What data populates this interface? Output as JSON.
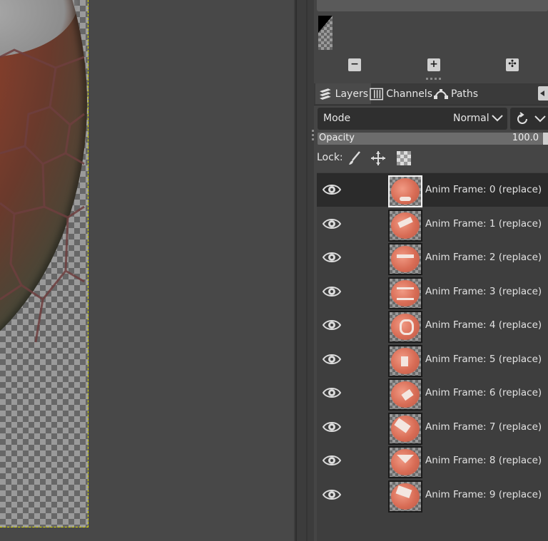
{
  "dock": {
    "tabs": [
      {
        "label": "Layers",
        "icon": "layers-icon",
        "active": true
      },
      {
        "label": "Channels",
        "icon": "channels-icon",
        "active": false
      },
      {
        "label": "Paths",
        "icon": "paths-icon",
        "active": false
      }
    ],
    "brush_buttons": [
      {
        "icon": "minus-icon",
        "glyph": "−"
      },
      {
        "icon": "plus-icon",
        "glyph": "+"
      },
      {
        "icon": "fit-icon",
        "glyph": "✣"
      }
    ]
  },
  "layers_panel": {
    "mode_label": "Mode",
    "mode_value": "Normal",
    "opacity_label": "Opacity",
    "opacity_value": "100.0",
    "opacity_fraction": 1.0,
    "lock_label": "Lock:",
    "lock_icons": [
      "paintbrush-icon",
      "move-icon",
      "alpha-checker-icon"
    ],
    "layers": [
      {
        "name": "Anim Frame: 0 (replace)",
        "visible": true,
        "selected": true
      },
      {
        "name": "Anim Frame: 1 (replace)",
        "visible": true,
        "selected": false
      },
      {
        "name": "Anim Frame: 2 (replace)",
        "visible": true,
        "selected": false
      },
      {
        "name": "Anim Frame: 3 (replace)",
        "visible": true,
        "selected": false
      },
      {
        "name": "Anim Frame: 4 (replace)",
        "visible": true,
        "selected": false
      },
      {
        "name": "Anim Frame: 5 (replace)",
        "visible": true,
        "selected": false
      },
      {
        "name": "Anim Frame: 6 (replace)",
        "visible": true,
        "selected": false
      },
      {
        "name": "Anim Frame: 7 (replace)",
        "visible": true,
        "selected": false
      },
      {
        "name": "Anim Frame: 8 (replace)",
        "visible": true,
        "selected": false
      },
      {
        "name": "Anim Frame: 9 (replace)",
        "visible": true,
        "selected": false
      }
    ]
  },
  "colors": {
    "selection_border": "#e3e300",
    "selected_row": "#2b2b2b",
    "panel_bg": "#454545"
  }
}
